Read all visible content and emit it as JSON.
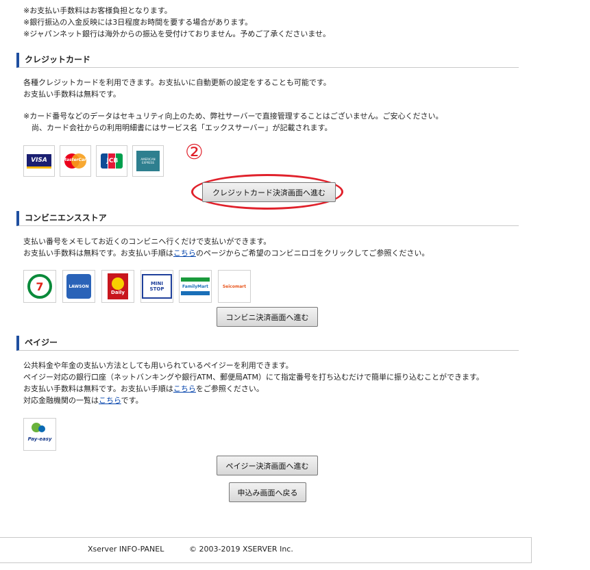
{
  "notes_top": [
    "※お支払い手数料はお客様負担となります。",
    "※銀行振込の入金反映には3日程度お時間を要する場合があります。",
    "※ジャパンネット銀行は海外からの振込を受付けておりません。予めご了承くださいませ。"
  ],
  "credit": {
    "heading": "クレジットカード",
    "desc1": "各種クレジットカードを利用できます。お支払いに自動更新の設定をすることも可能です。",
    "desc2": "お支払い手数料は無料です。",
    "note1": "※カード番号などのデータはセキュリティ向上のため、弊社サーバーで直接管理することはございません。ご安心ください。",
    "note2": "尚、カード会社からの利用明細書にはサービス名「エックスサーバー」が記載されます。",
    "logos": [
      "VISA",
      "MasterCard",
      "JCB",
      "AMERICAN EXPRESS"
    ],
    "step_marker": "②",
    "button": "クレジットカード決済画面へ進む",
    "highlight_color": "#e0212b"
  },
  "konbini": {
    "heading": "コンビニエンスストア",
    "desc1": "支払い番号をメモしてお近くのコンビニへ行くだけで支払いができます。",
    "desc2_pre": "お支払い手数料は無料です。お支払い手順は",
    "desc2_link": "こちら",
    "desc2_post": "のページからご希望のコンビニロゴをクリックしてご参照ください。",
    "logos": [
      "7",
      "LAWSON",
      "Daily",
      "MINI STOP",
      "FamilyMart",
      "Seicomart"
    ],
    "button": "コンビニ決済画面へ進む"
  },
  "payeasy": {
    "heading": "ペイジー",
    "desc1": "公共料金や年金の支払い方法としても用いられているペイジーを利用できます。",
    "desc2": "ペイジー対応の銀行口座（ネットバンキングや銀行ATM、郵便局ATM）にて指定番号を打ち込むだけで簡単に振り込むことができます。",
    "desc3_pre": "お支払い手数料は無料です。お支払い手順は",
    "desc3_link": "こちら",
    "desc3_post": "をご参照ください。",
    "desc4_pre": "対応金融機関の一覧は",
    "desc4_link": "こちら",
    "desc4_post": "です。",
    "logo": "Pay-easy",
    "button": "ペイジー決済画面へ進む"
  },
  "back_button": "申込み画面へ戻る",
  "footer": {
    "product": "Xserver INFO-PANEL",
    "copyright": "© 2003-2019 XSERVER Inc."
  }
}
